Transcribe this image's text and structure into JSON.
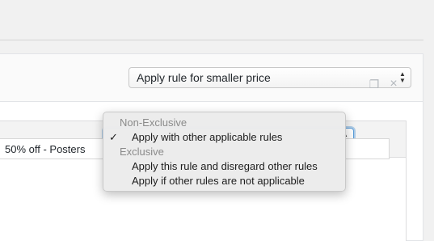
{
  "main_select": {
    "value": "Apply rule for smaller price"
  },
  "rule": {
    "title_value": "50% off - Posters"
  },
  "dropdown": {
    "groups": [
      {
        "label": "Non-Exclusive",
        "options": [
          {
            "label": "Apply with other applicable rules",
            "selected": true
          }
        ]
      },
      {
        "label": "Exclusive",
        "options": [
          {
            "label": "Apply this rule and disregard other rules",
            "selected": false
          },
          {
            "label": "Apply if other rules are not applicable",
            "selected": false
          }
        ]
      }
    ],
    "check_glyph": "✓"
  },
  "icons": {
    "arrows": "up-down-arrows-icon",
    "copy": "copy-icon",
    "close": "close-icon"
  },
  "colors": {
    "focus_ring": "#5b9dd9",
    "group_label": "#8a8a8a",
    "icon_gray": "#b4b9be"
  }
}
